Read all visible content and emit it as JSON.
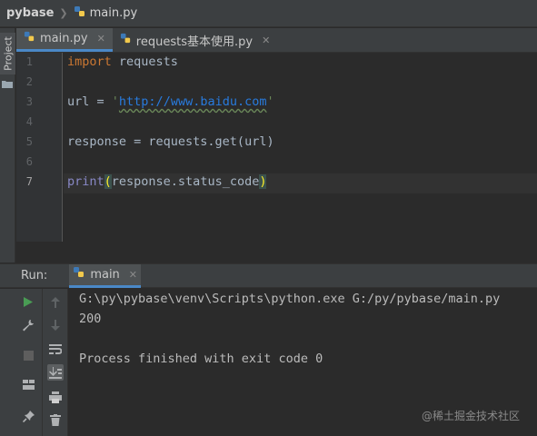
{
  "navbar": {
    "project": "pybase",
    "file": "main.py"
  },
  "left_stripe": {
    "project_tab": "Project"
  },
  "editor": {
    "tabs": [
      {
        "label": "main.py",
        "active": true,
        "icon": "python-file-icon"
      },
      {
        "label": "requests基本使用.py",
        "active": false,
        "icon": "python-file-icon"
      }
    ],
    "line_numbers": [
      "1",
      "2",
      "3",
      "4",
      "5",
      "6",
      "7"
    ],
    "current_line": "7",
    "lines": {
      "l1_kw": "import",
      "l1_rest": " requests",
      "l3_var": "url = ",
      "l3_q1": "'",
      "l3_url": "http://www.baidu.com",
      "l3_q2": "'",
      "l5": "response = requests.get(url)",
      "l7_fn": "print",
      "l7_open": "(",
      "l7_body": "response.status_code",
      "l7_close": ")"
    }
  },
  "run": {
    "title": "Run:",
    "tab_label": "main",
    "console": [
      "G:\\py\\pybase\\venv\\Scripts\\python.exe G:/py/pybase/main.py",
      "200",
      "",
      "Process finished with exit code 0"
    ]
  },
  "watermark": "@稀土掘金技术社区",
  "colors": {
    "accent": "#4a88c7",
    "run_green": "#499c54",
    "keyword": "#cc7832",
    "string": "#6a8759"
  }
}
